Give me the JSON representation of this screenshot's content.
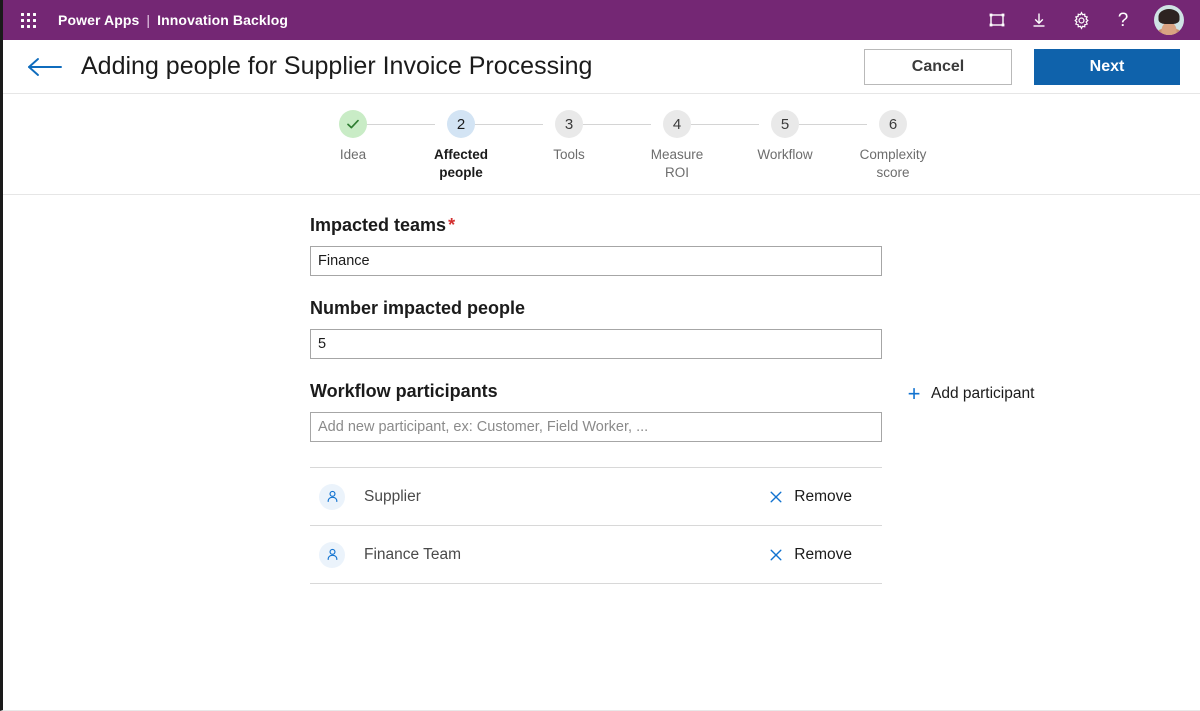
{
  "topbar": {
    "waffle_label": "app-launcher",
    "product": "Power Apps",
    "separator": "|",
    "app_name": "Innovation Backlog",
    "icons": [
      {
        "name": "frame-icon",
        "glyph": "frame"
      },
      {
        "name": "download-icon",
        "glyph": "download"
      },
      {
        "name": "gear-icon",
        "glyph": "gear"
      },
      {
        "name": "help-icon",
        "glyph": "?"
      }
    ],
    "avatar_alt": "user-avatar"
  },
  "header": {
    "back_label": "back",
    "title": "Adding people for Supplier Invoice Processing",
    "cancel_label": "Cancel",
    "next_label": "Next"
  },
  "stepper": {
    "steps": [
      {
        "number": "1",
        "label": "Idea",
        "state": "done",
        "marker": "✓"
      },
      {
        "number": "2",
        "label": "Affected\npeople",
        "state": "active",
        "marker": "2"
      },
      {
        "number": "3",
        "label": "Tools",
        "state": "pending",
        "marker": "3"
      },
      {
        "number": "4",
        "label": "Measure\nROI",
        "state": "pending",
        "marker": "4"
      },
      {
        "number": "5",
        "label": "Workflow",
        "state": "pending",
        "marker": "5"
      },
      {
        "number": "6",
        "label": "Complexity\nscore",
        "state": "pending",
        "marker": "6"
      }
    ]
  },
  "form": {
    "impacted_teams": {
      "label": "Impacted teams",
      "required_marker": "*",
      "value": "Finance",
      "placeholder": ""
    },
    "number_impacted_people": {
      "label": "Number impacted people",
      "value": "5",
      "placeholder": ""
    },
    "workflow_participants": {
      "label": "Workflow participants",
      "value": "",
      "placeholder": "Add new participant, ex: Customer, Field Worker, ...",
      "add_button_label": "Add participant",
      "add_button_icon": "+"
    },
    "participants": [
      {
        "name": "Supplier",
        "remove_label": "Remove"
      },
      {
        "name": "Finance Team",
        "remove_label": "Remove"
      }
    ]
  },
  "colors": {
    "brand_purple": "#742774",
    "primary_blue": "#0f62ab",
    "link_blue": "#1273d0",
    "required_red": "#d32f2f",
    "step_done_green": "#c9ecc6",
    "step_active_blue": "#d3e4f4",
    "step_pending_gray": "#e9e9e9"
  }
}
